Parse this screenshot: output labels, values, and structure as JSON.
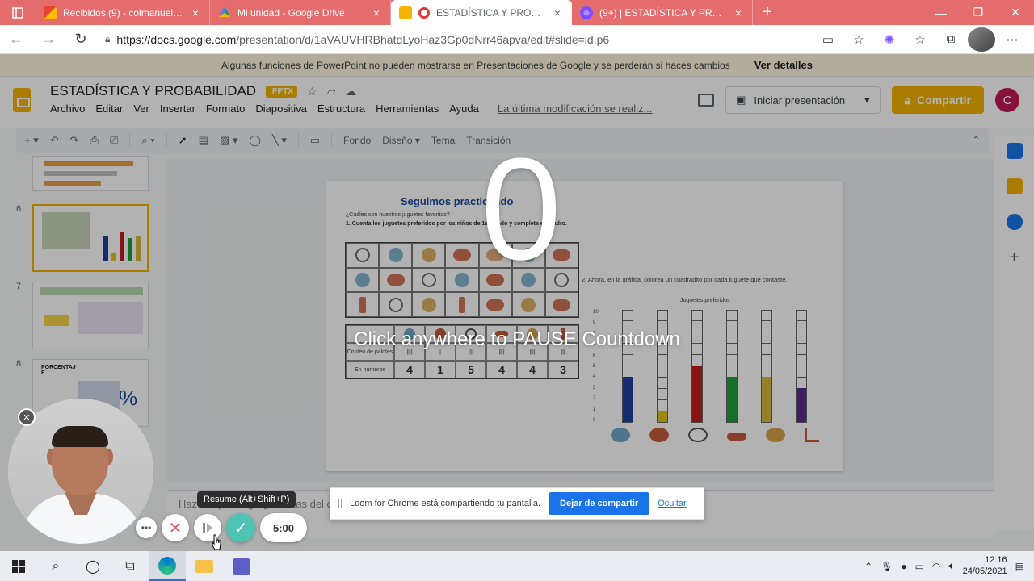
{
  "browser": {
    "tabs": [
      {
        "title": "Recibidos (9) - colmanuelita4jm@",
        "favicon": "gmail-icon",
        "active": false
      },
      {
        "title": "Mi unidad - Google Drive",
        "favicon": "drive-icon",
        "active": false
      },
      {
        "title": "ESTADÍSTICA Y PROBABILID",
        "favicon": "slides-icon",
        "active": true
      },
      {
        "title": "(9+) | ESTADÍSTICA Y PROBABILI",
        "favicon": "teams-icon",
        "active": false
      }
    ],
    "url_host": "https://docs.google.com",
    "url_path": "/presentation/d/1aVAUVHRBhatdLyoHaz3Gp0dNrr46apva/edit#slide=id.p6"
  },
  "warning": {
    "text": "Algunas funciones de PowerPoint no pueden mostrarse en Presentaciones de Google y se perderán si haces cambios",
    "link": "Ver detalles"
  },
  "doc": {
    "title": "ESTADÍSTICA Y PROBABILIDAD",
    "badge": ".PPTX",
    "menus": [
      "Archivo",
      "Editar",
      "Ver",
      "Insertar",
      "Formato",
      "Diapositiva",
      "Estructura",
      "Herramientas",
      "Ayuda"
    ],
    "last_edit": "La última modificación se realiz...",
    "present_label": "Iniciar presentación",
    "share_label": "Compartir",
    "user_initial": "C"
  },
  "toolbar": {
    "bg": "Fondo",
    "design": "Diseño",
    "theme": "Tema",
    "transition": "Transición"
  },
  "filmstrip": {
    "numbers": [
      "6",
      "7",
      "8"
    ],
    "slide8_label": "PORCENTAJ E",
    "slide8_symbol": "%"
  },
  "slide": {
    "title": "Seguimos practicando",
    "sub1": "¿Cuáles son nuestros juguetes favoritos?",
    "q1": "1.  Cuenta los juguetes preferidos por los niños de 1er grado y completa el cuadro.",
    "row_label_1": "Conteo de palotes",
    "row_label_2": "En números",
    "counts": [
      "4",
      "1",
      "5",
      "4",
      "4",
      "3"
    ],
    "q2": "2.  Ahora, en la gráfica, colorea un cuadradito por cada juguete que contaste.",
    "chart_title": "Juguetes preferidos",
    "yticks": [
      "0",
      "1",
      "2",
      "3",
      "4",
      "5",
      "6",
      "7",
      "8",
      "9",
      "10"
    ]
  },
  "chart_data": {
    "type": "bar",
    "title": "Juguetes preferidos",
    "categories": [
      "pelota de playa",
      "pelota de ping pong",
      "bicicleta",
      "patineta",
      "balón",
      "scooter"
    ],
    "values": [
      4,
      1,
      5,
      4,
      4,
      3
    ],
    "colors": [
      "#1f3f9e",
      "#e6c21a",
      "#c21a1a",
      "#1f9e3a",
      "#d6b63a",
      "#5a2a8a"
    ],
    "ylim": [
      0,
      10
    ]
  },
  "notes": {
    "placeholder": "Haz clic para agregar notas del orador"
  },
  "loom": {
    "countdown": "0",
    "message": "Click anywhere to PAUSE Countdown",
    "tooltip": "Resume (Alt+Shift+P)",
    "timer": "5:00",
    "share_text": "Loom for Chrome está compartiendo tu pantalla.",
    "stop_label": "Dejar de compartir",
    "hide_label": "Ocultar"
  },
  "taskbar": {
    "time": "12:16",
    "date": "24/05/2021"
  }
}
